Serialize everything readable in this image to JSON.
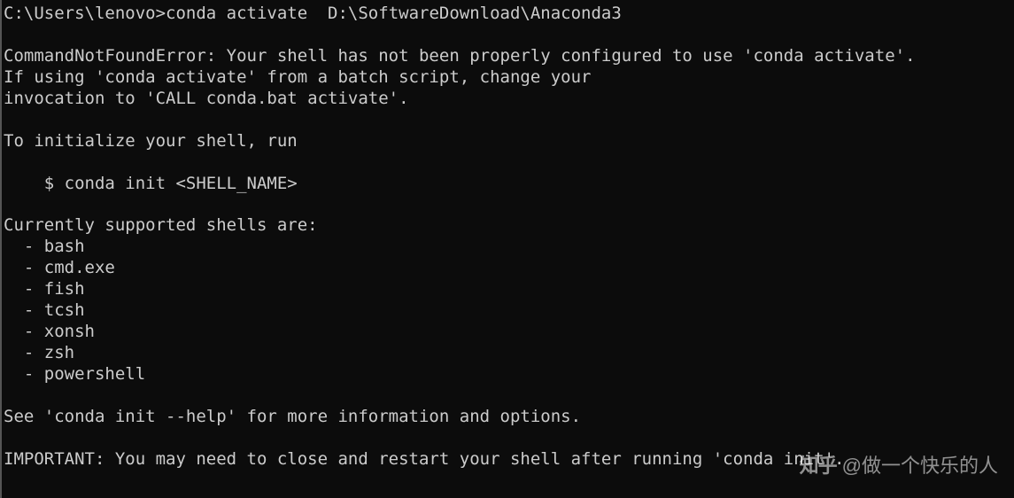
{
  "terminal": {
    "prompt": "C:\\Users\\lenovo>",
    "command": "conda activate  D:\\SoftwareDownload\\Anaconda3",
    "output_lines": [
      "",
      "CommandNotFoundError: Your shell has not been properly configured to use 'conda activate'.",
      "If using 'conda activate' from a batch script, change your",
      "invocation to 'CALL conda.bat activate'.",
      "",
      "To initialize your shell, run",
      "",
      "    $ conda init <SHELL_NAME>",
      "",
      "Currently supported shells are:",
      "  - bash",
      "  - cmd.exe",
      "  - fish",
      "  - tcsh",
      "  - xonsh",
      "  - zsh",
      "  - powershell",
      "",
      "See 'conda init --help' for more information and options.",
      "",
      "IMPORTANT: You may need to close and restart your shell after running 'conda init'."
    ]
  },
  "watermark": {
    "logo": "知乎",
    "text": "@做一个快乐的人"
  }
}
